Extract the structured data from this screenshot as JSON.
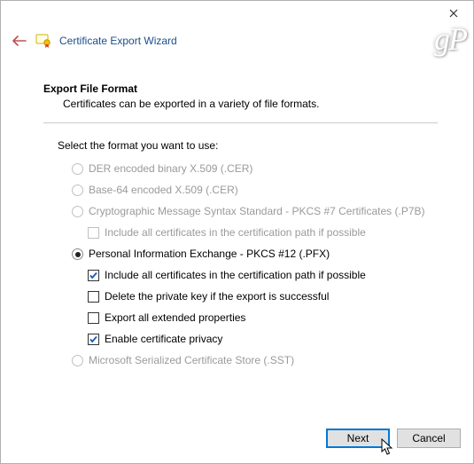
{
  "watermark": "gP",
  "header": {
    "title": "Certificate Export Wizard"
  },
  "section": {
    "heading": "Export File Format",
    "sub": "Certificates can be exported in a variety of file formats."
  },
  "prompt": "Select the format you want to use:",
  "options": {
    "der": {
      "label": "DER encoded binary X.509 (.CER)",
      "enabled": false,
      "selected": false
    },
    "base64": {
      "label": "Base-64 encoded X.509 (.CER)",
      "enabled": false,
      "selected": false
    },
    "pkcs7": {
      "label": "Cryptographic Message Syntax Standard - PKCS #7 Certificates (.P7B)",
      "enabled": false,
      "selected": false,
      "include_chain": {
        "label": "Include all certificates in the certification path if possible",
        "checked": false,
        "enabled": false
      }
    },
    "pfx": {
      "label": "Personal Information Exchange - PKCS #12 (.PFX)",
      "enabled": true,
      "selected": true,
      "include_chain": {
        "label": "Include all certificates in the certification path if possible",
        "checked": true
      },
      "delete_key": {
        "label": "Delete the private key if the export is successful",
        "checked": false
      },
      "extended": {
        "label": "Export all extended properties",
        "checked": false
      },
      "privacy": {
        "label": "Enable certificate privacy",
        "checked": true
      }
    },
    "sst": {
      "label": "Microsoft Serialized Certificate Store (.SST)",
      "enabled": false,
      "selected": false
    }
  },
  "buttons": {
    "next": "Next",
    "cancel": "Cancel"
  }
}
